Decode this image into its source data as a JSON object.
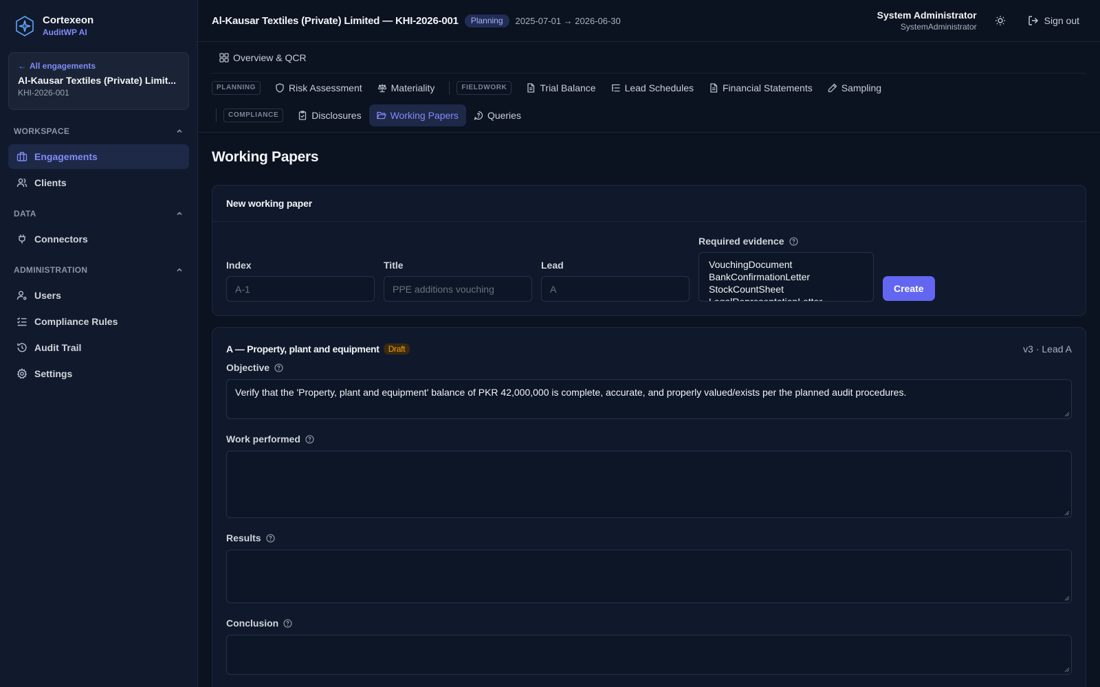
{
  "brand": {
    "name": "Cortexeon",
    "sub": "AuditWP AI"
  },
  "engagement": {
    "back_label": "All engagements",
    "name": "Al-Kausar Textiles (Private) Limit...",
    "code": "KHI-2026-001"
  },
  "sidebar": {
    "sections": [
      {
        "title": "WORKSPACE",
        "items": [
          {
            "label": "Engagements",
            "icon": "briefcase-icon",
            "active": true
          },
          {
            "label": "Clients",
            "icon": "users-icon"
          }
        ]
      },
      {
        "title": "DATA",
        "items": [
          {
            "label": "Connectors",
            "icon": "plug-icon"
          }
        ]
      },
      {
        "title": "ADMINISTRATION",
        "items": [
          {
            "label": "Users",
            "icon": "user-cog-icon"
          },
          {
            "label": "Compliance Rules",
            "icon": "list-checks-icon"
          },
          {
            "label": "Audit Trail",
            "icon": "history-icon"
          },
          {
            "label": "Settings",
            "icon": "gear-icon"
          }
        ]
      }
    ]
  },
  "topbar": {
    "title": "Al-Kausar Textiles (Private) Limited — KHI-2026-001",
    "status": "Planning",
    "dates": "2025-07-01 → 2026-06-30",
    "user_name": "System Administrator",
    "user_sub": "SystemAdministrator",
    "signout_label": "Sign out"
  },
  "nav": {
    "overview": "Overview & QCR",
    "planning_label": "PLANNING",
    "risk": "Risk Assessment",
    "materiality": "Materiality",
    "fieldwork_label": "FIELDWORK",
    "trial_balance": "Trial Balance",
    "lead_schedules": "Lead Schedules",
    "financial_statements": "Financial Statements",
    "sampling": "Sampling",
    "compliance_label": "COMPLIANCE",
    "disclosures": "Disclosures",
    "working_papers": "Working Papers",
    "queries": "Queries"
  },
  "page": {
    "title": "Working Papers"
  },
  "new_wp": {
    "heading": "New working paper",
    "index_label": "Index",
    "index_placeholder": "A-1",
    "title_label": "Title",
    "title_placeholder": "PPE additions vouching",
    "lead_label": "Lead",
    "lead_placeholder": "A",
    "evidence_label": "Required evidence",
    "evidence_options": [
      "VouchingDocument",
      "BankConfirmationLetter",
      "StockCountSheet",
      "LegalRepresentationLetter"
    ],
    "create_label": "Create"
  },
  "wp": {
    "title": "A — Property, plant and equipment",
    "status": "Draft",
    "meta": "v3 · Lead A",
    "objective_label": "Objective",
    "objective_text": "Verify that the 'Property, plant and equipment' balance of PKR 42,000,000 is complete, accurate, and properly valued/exists per the planned audit procedures.",
    "work_label": "Work performed",
    "work_text": "",
    "results_label": "Results",
    "results_text": "",
    "conclusion_label": "Conclusion",
    "conclusion_text": ""
  }
}
